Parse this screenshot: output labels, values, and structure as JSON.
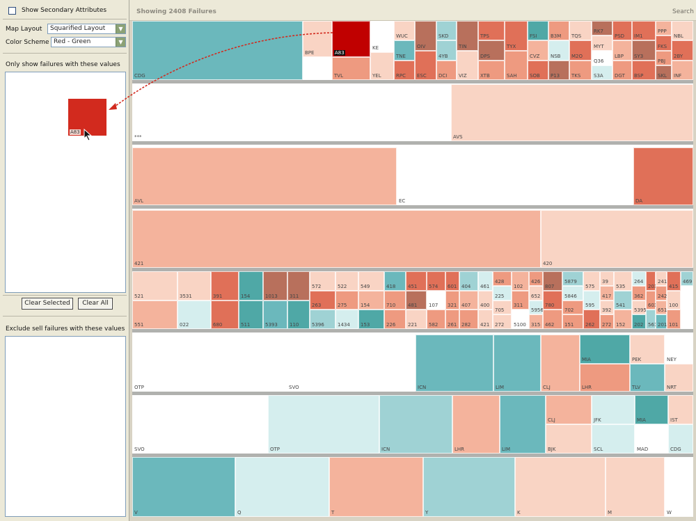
{
  "sidebar": {
    "show_secondary_label": "Show Secondary Attributes",
    "map_layout_label": "Map Layout",
    "map_layout_value": "Squarified Layout",
    "color_scheme_label": "Color Scheme",
    "color_scheme_value": "Red - Green",
    "only_show_label": "Only show failures with these values",
    "selected_chip_label": "A83",
    "clear_selected_label": "Clear Selected",
    "clear_all_label": "Clear All",
    "exclude_label": "Exclude sell failures with these values"
  },
  "header": {
    "showing_label": "Showing 2408 Failures",
    "search_label": "Search"
  },
  "treemap": {
    "colors": {
      "teal": "#6bb8bc",
      "teal_dark": "#4fa8a6",
      "teal_light": "#9fd2d4",
      "teal_pale": "#d5eeee",
      "white": "#ffffff",
      "salmon": "#f4b39c",
      "salmon_pale": "#f9d4c4",
      "salmon_mid": "#ee9a80",
      "red_mid": "#e07058",
      "red": "#d24a32",
      "red_dark": "#c00000",
      "brown": "#b8705c",
      "accent": "#d22a1e"
    },
    "groups": [
      {
        "cells": [
          {
            "l": "CDG",
            "c": "teal"
          },
          {
            "l": "BPE",
            "c": "salmon_pale"
          },
          {
            "l": "A83",
            "c": "red_dark",
            "dark": true
          },
          {
            "l": "TVL",
            "c": "salmon_mid"
          },
          {
            "l": "KE",
            "c": "white"
          },
          {
            "l": "YEL",
            "c": "salmon_pale"
          },
          {
            "l": "WUC",
            "c": "salmon_pale"
          },
          {
            "l": "TNE",
            "c": "teal"
          },
          {
            "l": "RPC",
            "c": "red_mid"
          },
          {
            "l": "OIV",
            "c": "brown"
          },
          {
            "l": "ESC",
            "c": "red_mid"
          },
          {
            "l": "SKD",
            "c": "teal_light"
          },
          {
            "l": "4YB",
            "c": "teal_light"
          },
          {
            "l": "DCI",
            "c": "salmon_mid"
          },
          {
            "l": "TIN",
            "c": "brown"
          },
          {
            "l": "VIZ",
            "c": "salmon_pale"
          },
          {
            "l": "TPS",
            "c": "red_mid"
          },
          {
            "l": "DPS",
            "c": "brown"
          },
          {
            "l": "XTB",
            "c": "salmon_mid"
          },
          {
            "l": "TYX",
            "c": "red_mid"
          },
          {
            "l": "SAH",
            "c": "salmon_mid"
          },
          {
            "l": "FSI",
            "c": "teal_dark"
          },
          {
            "l": "CVZ",
            "c": "salmon"
          },
          {
            "l": "SOB",
            "c": "red_mid"
          },
          {
            "l": "B3M",
            "c": "salmon_mid"
          },
          {
            "l": "NSB",
            "c": "teal_pale"
          },
          {
            "l": "P13",
            "c": "brown"
          },
          {
            "l": "TQS",
            "c": "salmon_pale"
          },
          {
            "l": "M2O",
            "c": "red_mid"
          },
          {
            "l": "TKS",
            "c": "salmon_mid"
          },
          {
            "l": "RK7",
            "c": "brown"
          },
          {
            "l": "MYT",
            "c": "salmon_pale"
          },
          {
            "l": "Q36",
            "c": "white"
          },
          {
            "l": "S3A",
            "c": "teal_pale"
          },
          {
            "l": "PSD",
            "c": "red_mid"
          },
          {
            "l": "LBP",
            "c": "salmon"
          },
          {
            "l": "DGT",
            "c": "salmon_mid"
          },
          {
            "l": "IM1",
            "c": "red_mid"
          },
          {
            "l": "SY3",
            "c": "brown"
          },
          {
            "l": "BSP",
            "c": "red_mid"
          },
          {
            "l": "PPP",
            "c": "salmon"
          },
          {
            "l": "FKS",
            "c": "red_mid"
          },
          {
            "l": "PBJ",
            "c": "salmon_mid"
          },
          {
            "l": "SKL",
            "c": "brown"
          },
          {
            "l": "NBL",
            "c": "salmon_pale"
          },
          {
            "l": "2BY",
            "c": "red_mid"
          },
          {
            "l": "INF",
            "c": "salmon"
          },
          {
            "l": "SH7",
            "c": "brown"
          },
          {
            "l": "MSS",
            "c": "salmon_mid"
          },
          {
            "l": "S4U",
            "c": "red_mid"
          },
          {
            "l": "HB7",
            "c": "brown"
          },
          {
            "l": "SKB",
            "c": "salmon_mid"
          },
          {
            "l": "SZ3",
            "c": "red_mid"
          },
          {
            "l": "TKZ",
            "c": "salmon"
          }
        ]
      },
      {
        "cells": [
          {
            "l": "***",
            "c": "white"
          },
          {
            "l": "AVS",
            "c": "salmon_pale"
          }
        ]
      },
      {
        "cells": [
          {
            "l": "AVL",
            "c": "salmon"
          },
          {
            "l": "EC",
            "c": "white"
          },
          {
            "l": "DA",
            "c": "red_mid"
          }
        ]
      },
      {
        "cells": [
          {
            "l": "421",
            "c": "salmon"
          },
          {
            "l": "420",
            "c": "salmon_pale"
          }
        ]
      },
      {
        "cells": [
          {
            "l": "521",
            "c": "salmon_pale"
          },
          {
            "l": "551",
            "c": "salmon"
          },
          {
            "l": "3531",
            "c": "salmon_pale"
          },
          {
            "l": "022",
            "c": "teal_pale"
          },
          {
            "l": "391",
            "c": "red_mid"
          },
          {
            "l": "680",
            "c": "red_mid"
          },
          {
            "l": "154",
            "c": "teal_dark"
          },
          {
            "l": "511",
            "c": "teal_dark"
          },
          {
            "l": "1013",
            "c": "brown"
          },
          {
            "l": "5393",
            "c": "teal"
          },
          {
            "l": "311",
            "c": "brown"
          },
          {
            "l": "110",
            "c": "teal_dark"
          },
          {
            "l": "572",
            "c": "salmon_pale"
          },
          {
            "l": "263",
            "c": "red_mid"
          },
          {
            "l": "5396",
            "c": "teal_light"
          },
          {
            "l": "522",
            "c": "salmon_pale"
          },
          {
            "l": "275",
            "c": "salmon_mid"
          },
          {
            "l": "1434",
            "c": "teal_pale"
          },
          {
            "l": "549",
            "c": "salmon_pale"
          },
          {
            "l": "154",
            "c": "salmon"
          },
          {
            "l": "153",
            "c": "teal_dark"
          },
          {
            "l": "418",
            "c": "teal"
          },
          {
            "l": "710",
            "c": "salmon_mid"
          },
          {
            "l": "226",
            "c": "salmon_mid"
          },
          {
            "l": "451",
            "c": "red_mid"
          },
          {
            "l": "481",
            "c": "brown"
          },
          {
            "l": "221",
            "c": "salmon_pale"
          },
          {
            "l": "574",
            "c": "red_mid"
          },
          {
            "l": "107",
            "c": "white"
          },
          {
            "l": "582",
            "c": "salmon_mid"
          },
          {
            "l": "601",
            "c": "red_mid"
          },
          {
            "l": "321",
            "c": "salmon_mid"
          },
          {
            "l": "261",
            "c": "salmon_mid"
          },
          {
            "l": "404",
            "c": "teal_light"
          },
          {
            "l": "407",
            "c": "salmon"
          },
          {
            "l": "282",
            "c": "salmon_mid"
          },
          {
            "l": "461",
            "c": "teal_pale"
          },
          {
            "l": "400",
            "c": "salmon_pale"
          },
          {
            "l": "421",
            "c": "salmon_pale"
          },
          {
            "l": "428",
            "c": "salmon_mid"
          },
          {
            "l": "225",
            "c": "teal_pale"
          },
          {
            "l": "705",
            "c": "salmon_pale"
          },
          {
            "l": "272",
            "c": "salmon_pale"
          },
          {
            "l": "102",
            "c": "salmon"
          },
          {
            "l": "311",
            "c": "salmon_mid"
          },
          {
            "l": "5100",
            "c": "white"
          },
          {
            "l": "426",
            "c": "salmon_mid"
          },
          {
            "l": "652",
            "c": "salmon_pale"
          },
          {
            "l": "5956",
            "c": "teal_pale"
          },
          {
            "l": "315",
            "c": "salmon"
          },
          {
            "l": "807",
            "c": "brown"
          },
          {
            "l": "780",
            "c": "red_mid"
          },
          {
            "l": "462",
            "c": "salmon_mid"
          },
          {
            "l": "5879",
            "c": "teal_light"
          },
          {
            "l": "5846",
            "c": "teal_pale"
          },
          {
            "l": "702",
            "c": "salmon_mid"
          },
          {
            "l": "151",
            "c": "salmon_mid"
          },
          {
            "l": "575",
            "c": "salmon_pale"
          },
          {
            "l": "595",
            "c": "teal_pale"
          },
          {
            "l": "262",
            "c": "red_mid"
          },
          {
            "l": "39",
            "c": "salmon_pale"
          },
          {
            "l": "417",
            "c": "salmon"
          },
          {
            "l": "392",
            "c": "salmon_pale"
          },
          {
            "l": "272",
            "c": "salmon_mid"
          },
          {
            "l": "535",
            "c": "salmon_pale"
          },
          {
            "l": "541",
            "c": "teal_light"
          },
          {
            "l": "152",
            "c": "salmon"
          },
          {
            "l": "264",
            "c": "teal_pale"
          },
          {
            "l": "362",
            "c": "salmon_mid"
          },
          {
            "l": "5395",
            "c": "salmon_pale"
          },
          {
            "l": "202",
            "c": "teal_dark"
          },
          {
            "l": "203",
            "c": "red_mid"
          },
          {
            "l": "603",
            "c": "salmon_mid"
          },
          {
            "l": "561",
            "c": "teal_light"
          },
          {
            "l": "241",
            "c": "salmon_pale"
          },
          {
            "l": "242",
            "c": "salmon_mid"
          },
          {
            "l": "651",
            "c": "salmon"
          },
          {
            "l": "201",
            "c": "teal"
          },
          {
            "l": "415",
            "c": "red_mid"
          },
          {
            "l": "100",
            "c": "salmon_pale"
          },
          {
            "l": "101",
            "c": "salmon_mid"
          },
          {
            "l": "469",
            "c": "teal_light"
          }
        ]
      },
      {
        "cells": [
          {
            "l": "OTP",
            "c": "white"
          },
          {
            "l": "SVO",
            "c": "white"
          },
          {
            "l": "ICN",
            "c": "teal"
          },
          {
            "l": "LIM",
            "c": "teal"
          },
          {
            "l": "CLJ",
            "c": "salmon"
          },
          {
            "l": "MIA",
            "c": "teal_dark"
          },
          {
            "l": "LHR",
            "c": "salmon_mid"
          },
          {
            "l": "PEK",
            "c": "salmon_pale"
          },
          {
            "l": "TLV",
            "c": "teal"
          },
          {
            "l": "NEY",
            "c": "white"
          },
          {
            "l": "NRT",
            "c": "salmon_pale"
          }
        ]
      },
      {
        "cells": [
          {
            "l": "SVO",
            "c": "white"
          },
          {
            "l": "OTP",
            "c": "teal_pale"
          },
          {
            "l": "ICN",
            "c": "teal_light"
          },
          {
            "l": "LHR",
            "c": "salmon"
          },
          {
            "l": "LIM",
            "c": "teal"
          },
          {
            "l": "CLJ",
            "c": "salmon"
          },
          {
            "l": "BJK",
            "c": "salmon_pale"
          },
          {
            "l": "JFK",
            "c": "teal_pale"
          },
          {
            "l": "MIA",
            "c": "teal_dark"
          },
          {
            "l": "SCL",
            "c": "teal_pale"
          },
          {
            "l": "MAD",
            "c": "white"
          },
          {
            "l": "IST",
            "c": "salmon_pale"
          },
          {
            "l": "CDG",
            "c": "teal_pale"
          }
        ]
      },
      {
        "cells": [
          {
            "l": "V",
            "c": "teal"
          },
          {
            "l": "Q",
            "c": "teal_pale"
          },
          {
            "l": "T",
            "c": "salmon"
          },
          {
            "l": "Y",
            "c": "teal_light"
          },
          {
            "l": "K",
            "c": "salmon_pale"
          },
          {
            "l": "M",
            "c": "salmon_pale"
          },
          {
            "l": "W",
            "c": "white"
          }
        ]
      }
    ]
  }
}
